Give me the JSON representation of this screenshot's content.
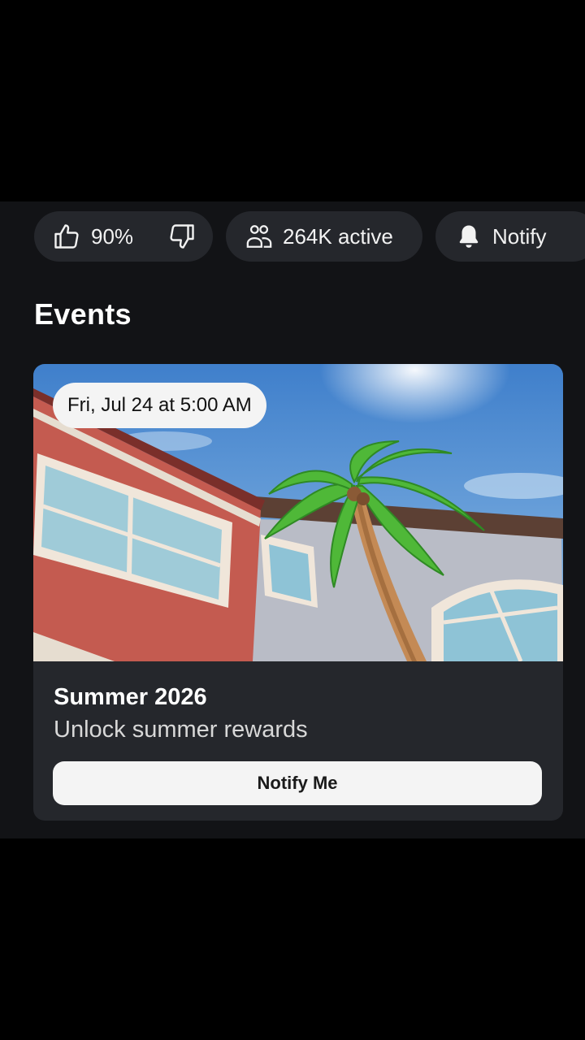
{
  "stats": {
    "rating": "90%",
    "active": "264K active",
    "notify_label": "Notify"
  },
  "events_section": {
    "title": "Events"
  },
  "event": {
    "date": "Fri, Jul 24 at 5:00 AM",
    "name": "Summer 2026",
    "description": "Unlock summer rewards",
    "button_label": "Notify Me",
    "image": "summer-scene-palm-tree-building"
  },
  "icons": {
    "like": "thumbs-up-icon",
    "dislike": "thumbs-down-icon",
    "players": "people-icon",
    "notify": "bell-icon"
  },
  "colors": {
    "background": "#121316",
    "pill": "#25272c",
    "button": "#f4f4f4"
  }
}
